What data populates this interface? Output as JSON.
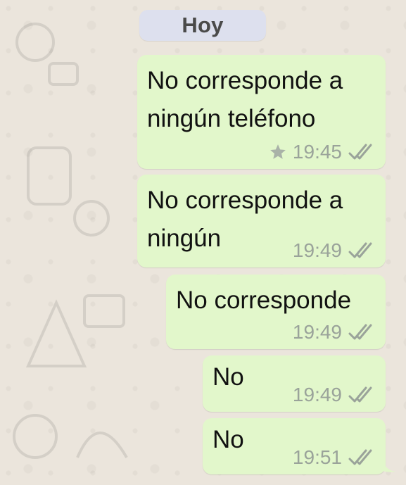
{
  "date_divider": {
    "label": "Hoy"
  },
  "messages": [
    {
      "text": "No corresponde a ningún teléfono",
      "line1": "No corresponde a",
      "line2": "ningún teléfono",
      "time": "19:45",
      "starred": true,
      "status_icon": "double-check-icon"
    },
    {
      "text": "No corresponde a ningún",
      "line1": "No corresponde a",
      "line2": "ningún",
      "time": "19:49",
      "starred": false,
      "status_icon": "double-check-icon"
    },
    {
      "text": "No corresponde",
      "line1": "No corresponde",
      "time": "19:49",
      "starred": false,
      "status_icon": "double-check-icon"
    },
    {
      "text": "No",
      "line1": "No",
      "time": "19:49",
      "starred": false,
      "status_icon": "double-check-icon"
    },
    {
      "text": "No",
      "line1": "No",
      "time": "19:51",
      "starred": false,
      "status_icon": "double-check-icon"
    }
  ],
  "colors": {
    "outgoing_bubble": "#e2f7cb",
    "background": "#ebe5dc",
    "date_pill": "#dde0ee",
    "meta_text": "#9aa39a"
  }
}
